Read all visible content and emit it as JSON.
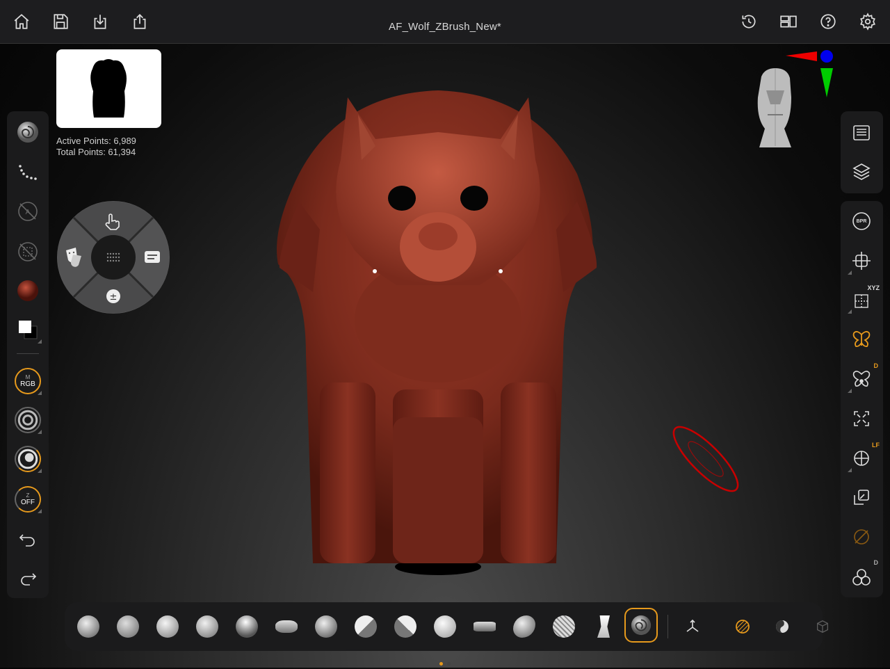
{
  "app": {
    "document_title": "AF_Wolf_ZBrush_New*"
  },
  "topbar": {
    "left_icons": [
      "home-icon",
      "save-icon",
      "import-icon",
      "share-icon"
    ],
    "right_icons": [
      "history-icon",
      "layout-icon",
      "help-icon",
      "settings-icon"
    ]
  },
  "thumbnail": {
    "kind": "silhouette-preview"
  },
  "stats": {
    "active_points": "Active Points: 6,989",
    "total_points": "Total Points: 61,394"
  },
  "left_toolbar": {
    "items": [
      {
        "name": "current-brush-icon"
      },
      {
        "name": "stroke-dots-icon"
      },
      {
        "name": "alpha-off-icon"
      },
      {
        "name": "texture-off-icon"
      },
      {
        "name": "material-icon",
        "color": "#7a2418"
      },
      {
        "name": "color-swatch-icon"
      },
      {
        "name": "mrgb-toggle",
        "line1": "M",
        "line2": "RGB"
      },
      {
        "name": "draw-size-icon"
      },
      {
        "name": "focal-shift-icon"
      },
      {
        "name": "z-intensity-toggle",
        "line1": "Z",
        "line2": "OFF"
      },
      {
        "name": "undo-icon"
      },
      {
        "name": "redo-icon"
      }
    ]
  },
  "right_toolbar": {
    "top": [
      "document-list-icon",
      "layers-icon"
    ],
    "bottom": [
      {
        "name": "bpr-render-icon",
        "label": "BPR"
      },
      {
        "name": "move-canvas-icon"
      },
      {
        "name": "symmetry-axis-icon",
        "sup": "XYZ"
      },
      {
        "name": "symmetry-icon"
      },
      {
        "name": "dynamic-symmetry-icon",
        "sup": "D"
      },
      {
        "name": "frame-icon"
      },
      {
        "name": "local-transform-icon",
        "sup": "LF"
      },
      {
        "name": "polyframe-icon"
      },
      {
        "name": "solo-icon"
      },
      {
        "name": "dynamesh-icon",
        "sup": "D"
      }
    ]
  },
  "bottom_bar": {
    "brushes": [
      "clay-buildup-brush",
      "clay-brush",
      "standard-brush",
      "dam-standard-brush",
      "inflate-brush",
      "move-brush",
      "snake-hook-brush",
      "trim-dynamic-brush",
      "hpolish-brush",
      "smooth-brush",
      "curve-tube-brush",
      "pinch-brush",
      "mask-lasso-brush",
      "select-rect-brush",
      "current-brush"
    ],
    "selected_index": 14,
    "tools": [
      "gizmo-icon",
      "material-toggle-icon",
      "matcap-icon"
    ],
    "accent": "#e79a1c"
  },
  "colors": {
    "accent": "#e79a1c",
    "clay": "#8a2a1c"
  }
}
